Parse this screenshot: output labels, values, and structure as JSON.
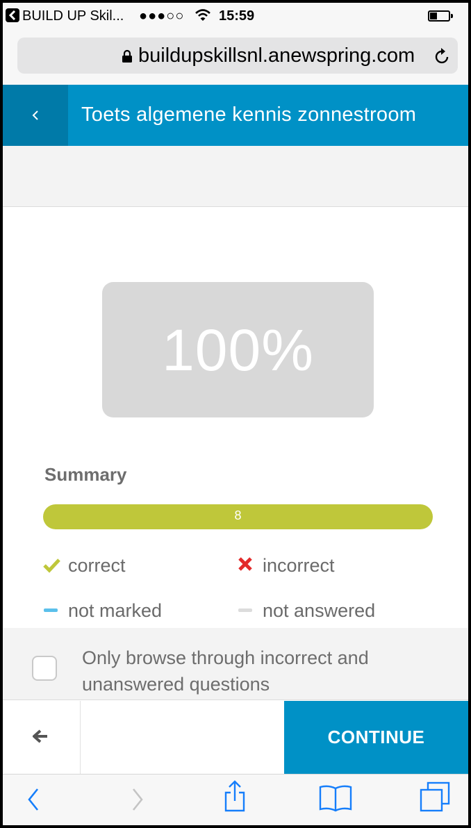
{
  "status_bar": {
    "app_name": "BUILD UP Skil...",
    "signal": "●●●○○",
    "time": "15:59"
  },
  "browser": {
    "url": "buildupskillsnl.anewspring.com"
  },
  "header": {
    "title": "Toets algemene kennis zonnestroom"
  },
  "result": {
    "score": "100%",
    "summary_label": "Summary",
    "correct_count": "8",
    "correct_fraction": 1.0
  },
  "legend": {
    "correct": "correct",
    "incorrect": "incorrect",
    "not_marked": "not marked",
    "not_answered": "not answered"
  },
  "filter": {
    "label": "Only browse through incorrect and unanswered questions",
    "checked": false
  },
  "nav": {
    "continue_label": "CONTINUE"
  },
  "colors": {
    "brand_blue": "#0091c6",
    "correct_green": "#bfc73a",
    "incorrect_red": "#e32b2b",
    "not_marked_blue": "#5bc0eb",
    "not_answered_gray": "#dcdcdc",
    "safari_blue": "#157efb"
  },
  "icons": {
    "back": "chevron-left-icon",
    "previous": "arrow-left-icon",
    "share": "share-icon",
    "bookmarks": "book-icon",
    "tabs": "tabs-icon"
  }
}
